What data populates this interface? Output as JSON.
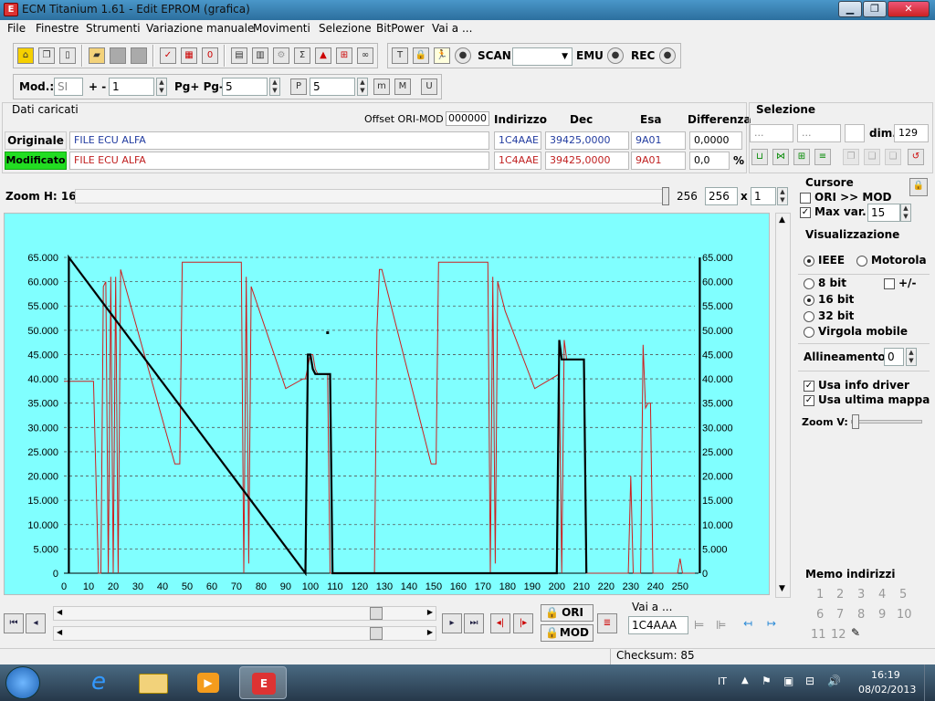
{
  "window": {
    "title": "ECM Titanium 1.61 - Edit EPROM (grafica)",
    "app_icon": "ecm-logo"
  },
  "menu": [
    "File",
    "Finestre",
    "Strumenti",
    "Variazione manuale",
    "Movimenti",
    "Selezione",
    "BitPower",
    "Vai a ..."
  ],
  "toolbar": {
    "scan_label": "SCAN",
    "emu_label": "EMU",
    "rec_label": "REC"
  },
  "toolbar2": {
    "mod_label": "Mod.:",
    "mod_value": "SI",
    "plusminus_label": "+ -",
    "plusminus_value": "1",
    "pg_label": "Pg+ Pg-",
    "pg_value": "5",
    "p_value": "5"
  },
  "loaded": {
    "title": "Dati caricati",
    "offset_label": "Offset ORI-MOD",
    "offset_value": "000000",
    "headers": {
      "address": "Indirizzo",
      "dec": "Dec",
      "hex": "Esa",
      "diff": "Differenza"
    },
    "original": {
      "label": "Originale",
      "file": "FILE ECU ALFA",
      "address": "1C4AAE",
      "dec": "39425,0000",
      "hex": "9A01",
      "diff": "0,0000"
    },
    "modified": {
      "label": "Modificato",
      "file": "FILE ECU ALFA",
      "address": "1C4AAE",
      "dec": "39425,0000",
      "hex": "9A01",
      "diff": "0,0",
      "pct": "%"
    }
  },
  "selection": {
    "title": "Selezione",
    "field1": "...",
    "field2": "...",
    "dim_label": "dim.",
    "dim_value": "129"
  },
  "zoom": {
    "label": "Zoom H: 16",
    "value_text": "256",
    "value_input": "256",
    "x_label": "x",
    "mult": "1"
  },
  "cursor": {
    "title": "Cursore",
    "ori_mod_label": "ORI >> MOD",
    "max_var_label": "Max var.",
    "max_var_value": "15"
  },
  "viz": {
    "title": "Visualizzazione",
    "ieee": "IEEE",
    "motorola": "Motorola",
    "bit8": "8 bit",
    "pm": "+/-",
    "bit16": "16 bit",
    "bit32": "32 bit",
    "float": "Virgola mobile",
    "align_label": "Allineamento:",
    "align_value": "0",
    "driver": "Usa info driver",
    "lastmap": "Usa ultima mappa",
    "zoomv": "Zoom V:"
  },
  "bottom": {
    "ori": "ORI",
    "mod": "MOD",
    "goto_label": "Vai a ...",
    "goto_value": "1C4AAA"
  },
  "memo": {
    "title": "Memo indirizzi",
    "items": [
      "1",
      "2",
      "3",
      "4",
      "5",
      "6",
      "7",
      "8",
      "9",
      "10",
      "11",
      "12"
    ]
  },
  "status": {
    "checksum": "Checksum: 85"
  },
  "taskbar": {
    "lang": "IT",
    "time": "16:19",
    "date": "08/02/2013"
  },
  "colors": {
    "plot_bg": "#80ffff",
    "original_line": "#cc2020",
    "modified_line": "#000000",
    "modified_label_bg": "#22dd22"
  },
  "chart_data": {
    "type": "line",
    "xlim": [
      0,
      256
    ],
    "ylim": [
      0,
      65000
    ],
    "x_ticks": [
      0,
      10,
      20,
      30,
      40,
      50,
      60,
      70,
      80,
      90,
      100,
      110,
      120,
      130,
      140,
      150,
      160,
      170,
      180,
      190,
      200,
      210,
      220,
      230,
      240,
      250
    ],
    "y_ticks": [
      0,
      5000,
      10000,
      15000,
      20000,
      25000,
      30000,
      35000,
      40000,
      45000,
      50000,
      55000,
      60000,
      65000
    ],
    "y_tick_labels": [
      "0",
      "5.000",
      "10.000",
      "15.000",
      "20.000",
      "25.000",
      "30.000",
      "35.000",
      "40.000",
      "45.000",
      "50.000",
      "55.000",
      "60.000",
      "65.000"
    ],
    "grid": true,
    "series": [
      {
        "color": "#cc2020",
        "x": [
          0,
          2,
          12,
          14,
          15,
          16,
          17,
          18,
          19,
          20,
          21,
          22,
          23,
          45,
          47,
          48,
          72,
          73,
          74,
          75,
          76,
          90,
          97,
          98,
          100,
          101,
          102,
          103,
          106,
          107,
          108,
          109,
          111,
          124,
          126,
          127,
          128,
          129,
          149,
          151,
          152,
          171,
          172,
          173,
          174,
          175,
          176,
          177,
          178,
          179,
          191,
          201,
          202,
          203,
          204,
          211,
          212,
          213,
          214,
          220,
          221,
          222,
          223,
          229,
          230,
          231,
          232,
          233,
          234,
          235,
          236,
          237,
          238,
          239,
          242,
          243,
          244,
          247,
          248,
          249,
          250,
          251,
          252,
          254,
          256
        ],
        "y": [
          39500,
          39500,
          39500,
          0,
          0,
          59000,
          60000,
          0,
          61000,
          0,
          61000,
          0,
          62500,
          22500,
          22500,
          64000,
          64000,
          0,
          61000,
          2000,
          59000,
          38000,
          40000,
          40000,
          45000,
          45000,
          42000,
          41000,
          41000,
          41000,
          0,
          0,
          0,
          0,
          0,
          50000,
          62500,
          62500,
          22500,
          22500,
          64000,
          64000,
          64000,
          0,
          61000,
          2000,
          60000,
          58000,
          56000,
          54000,
          38000,
          41000,
          0,
          48000,
          44000,
          44000,
          0,
          0,
          0,
          0,
          0,
          0,
          0,
          0,
          20000,
          0,
          0,
          0,
          0,
          47000,
          34000,
          35000,
          35000,
          0,
          0,
          0,
          0,
          0,
          0,
          0,
          3000,
          0,
          0,
          0,
          0
        ]
      },
      {
        "color": "#000000",
        "x": [
          2,
          2,
          98,
          99,
          100,
          101,
          102,
          103,
          106,
          107,
          108,
          109,
          200,
          201,
          202,
          203,
          204,
          211,
          212
        ],
        "y": [
          0,
          65000,
          0,
          45000,
          45000,
          42000,
          41000,
          41000,
          41000,
          41000,
          41000,
          0,
          0,
          48000,
          44000,
          44000,
          44000,
          44000,
          0
        ]
      },
      {
        "color": "#000000",
        "x": [
          258,
          258
        ],
        "y": [
          0,
          65000
        ]
      }
    ]
  }
}
